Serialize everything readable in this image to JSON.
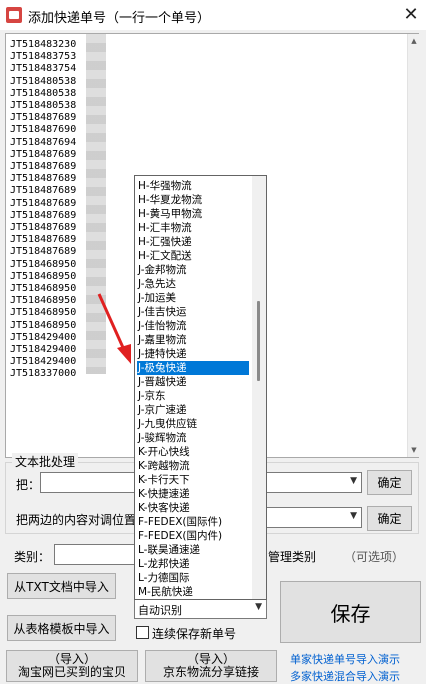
{
  "window": {
    "title": "添加快递单号（一行一个单号）",
    "close_glyph": "✕"
  },
  "tracking_list": {
    "lines": [
      "JT518483230",
      "JT518483753",
      "JT518483754",
      "JT518480538",
      "JT518480538",
      "JT518480538",
      "JT518487689",
      "JT518487690",
      "JT518487694",
      "JT518487689",
      "JT518487689",
      "JT518487689",
      "JT518487689",
      "JT518487689",
      "JT518487689",
      "JT518487689",
      "JT518487689",
      "JT518487689",
      "JT518468950",
      "JT518468950",
      "JT518468950",
      "JT518468950",
      "JT518468950",
      "JT518468950",
      "JT518429400",
      "JT518429400",
      "JT518429400",
      "JT518337000"
    ]
  },
  "batch": {
    "group_title": "文本批处理",
    "replace_label": "把：",
    "confirm_1": "确定",
    "swap_label": "把两边的内容对调位置",
    "confirm_2": "确定"
  },
  "category": {
    "label": "类别：",
    "manage_label": "管理类别",
    "optional_label": "（可选项）"
  },
  "buttons": {
    "import_txt": "从TXT文档中导入",
    "import_table": "从表格模板中导入",
    "save": "保存",
    "taobao_top": "（导入）",
    "taobao_bottom": "淘宝网已买到的宝贝",
    "jd_top": "（导入）",
    "jd_bottom": "京东物流分享链接"
  },
  "courier_select": {
    "value": "自动识别",
    "options": [
      "H-华强物流",
      "H-华夏龙物流",
      "H-黄马甲物流",
      "H-汇丰物流",
      "H-汇强快递",
      "H-汇文配送",
      "J-金邦物流",
      "J-急先达",
      "J-加运美",
      "J-佳吉快运",
      "J-佳怡物流",
      "J-嘉里物流",
      "J-捷特快递",
      "J-极兔快递",
      "J-晋越快递",
      "J-京东",
      "J-京广速递",
      "J-九曳供应链",
      "J-骏辉物流",
      "K-开心快线",
      "K-跨越物流",
      "K-卡行天下",
      "K-快捷速递",
      "K-快客快递",
      "F-FEDEX(国际件)",
      "F-FEDEX(国内件)",
      "L-联昊通速递",
      "L-龙邦快递",
      "L-力德国际",
      "M-民航快递"
    ],
    "selected_index": 13
  },
  "continuous_save": {
    "label": "连续保存新单号",
    "checked": false
  },
  "links": {
    "single_demo": "单家快递单号导入演示",
    "multi_demo": "多家快递混合导入演示"
  },
  "colors": {
    "selection": "#0078d7",
    "link": "#0060d0",
    "arrow": "#e02020"
  }
}
